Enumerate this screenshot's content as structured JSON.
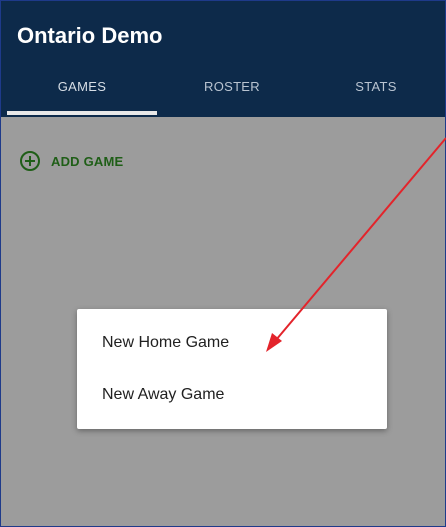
{
  "app": {
    "title": "Ontario Demo"
  },
  "tabs": [
    {
      "label": "GAMES",
      "active": true
    },
    {
      "label": "ROSTER",
      "active": false
    },
    {
      "label": "STATS",
      "active": false
    }
  ],
  "main": {
    "add_game_label": "ADD GAME",
    "add_icon": "plus-circle-icon"
  },
  "menu": {
    "items": [
      {
        "label": "New Home Game"
      },
      {
        "label": "New Away Game"
      }
    ]
  },
  "annotation": {
    "arrow_color": "#e3242b"
  },
  "colors": {
    "appbar": "#0d2a4a",
    "accent_green": "#1f5e17",
    "scrim": "#9c9c9c"
  }
}
